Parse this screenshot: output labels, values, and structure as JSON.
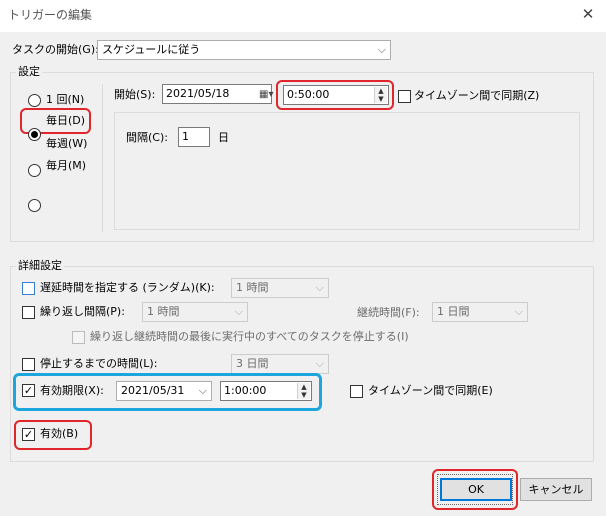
{
  "window": {
    "title": "トリガーの編集",
    "close_glyph": "✕"
  },
  "begin_task": {
    "label": "タスクの開始(G):",
    "value": "スケジュールに従う"
  },
  "settings": {
    "title": "設定",
    "radios": [
      {
        "label": "1 回(N)",
        "checked": false
      },
      {
        "label": "毎日(D)",
        "checked": true
      },
      {
        "label": "毎週(W)",
        "checked": false
      },
      {
        "label": "毎月(M)",
        "checked": false
      }
    ],
    "start_label": "開始(S):",
    "start_date": "2021/05/18",
    "start_time": "0:50:00",
    "sync_tz_label": "タイムゾーン間で同期(Z)",
    "interval_label": "間隔(C):",
    "interval_value": "1",
    "interval_unit": "日"
  },
  "advanced": {
    "title": "詳細設定",
    "delay_label": "遅延時間を指定する (ランダム)(K):",
    "delay_value": "1 時間",
    "repeat_label": "繰り返し間隔(P):",
    "repeat_value": "1 時間",
    "duration_label": "継続時間(F):",
    "duration_value": "1 日間",
    "stop_all_label": "繰り返し継続時間の最後に実行中のすべてのタスクを停止する(I)",
    "stop_after_label": "停止するまでの時間(L):",
    "stop_after_value": "3 日間",
    "expire_label": "有効期限(X):",
    "expire_date": "2021/05/31",
    "expire_time": "1:00:00",
    "expire_sync_label": "タイムゾーン間で同期(E)",
    "enabled_label": "有効(B)"
  },
  "buttons": {
    "ok": "OK",
    "cancel": "キャンセル"
  },
  "colors": {
    "highlight_red": "#e0262a",
    "highlight_blue": "#1ca6dd",
    "default_button_border": "#0078d7"
  }
}
